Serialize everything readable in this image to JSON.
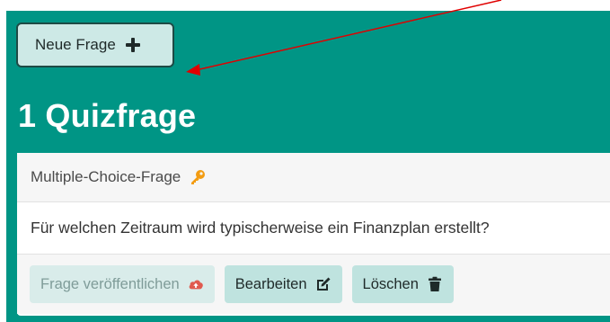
{
  "toolbar": {
    "new_question_label": "Neue Frage"
  },
  "page": {
    "title": "1 Quizfrage"
  },
  "question_card": {
    "type_label": "Multiple-Choice-Frage",
    "question_text": "Für welchen Zeitraum wird typischerweise ein Finanzplan erstellt?",
    "actions": {
      "publish_label": "Frage veröffentlichen",
      "edit_label": "Bearbeiten",
      "delete_label": "Löschen"
    }
  },
  "icons": {
    "new_question": "plus-icon",
    "type": "key-icon",
    "publish": "cloud-upload-icon",
    "edit": "edit-icon",
    "delete": "trash-icon",
    "annotation": "arrow"
  },
  "colors": {
    "background": "#009585",
    "button_bg": "#bfe3df",
    "key_orange": "#f39c12",
    "cloud_red": "#e05a4f",
    "annotation_red": "#e00000"
  }
}
